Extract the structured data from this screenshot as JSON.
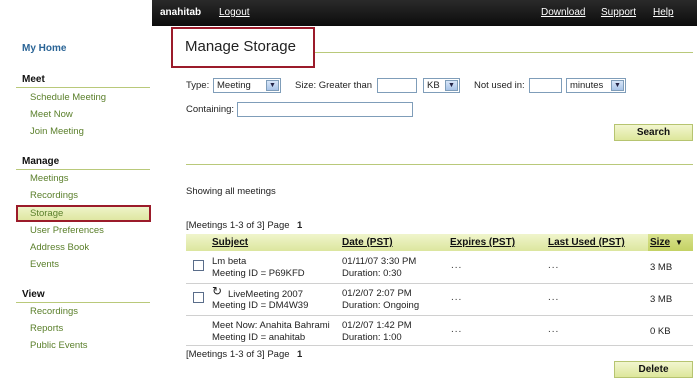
{
  "topbar": {
    "user": "anahitab",
    "logout": "Logout",
    "download": "Download",
    "support": "Support",
    "help": "Help"
  },
  "sidebar": {
    "home": "My Home",
    "meet": {
      "title": "Meet",
      "items": [
        "Schedule Meeting",
        "Meet Now",
        "Join Meeting"
      ]
    },
    "manage": {
      "title": "Manage",
      "items": [
        "Meetings",
        "Recordings",
        "Storage",
        "User Preferences",
        "Address Book",
        "Events"
      ]
    },
    "view": {
      "title": "View",
      "items": [
        "Recordings",
        "Reports",
        "Public Events"
      ]
    }
  },
  "page": {
    "title": "Manage Storage"
  },
  "filters": {
    "type_label": "Type:",
    "type_value": "Meeting",
    "size_label": "Size: Greater than",
    "size_value": "",
    "size_unit": "KB",
    "not_used_label": "Not used in:",
    "not_used_value": "",
    "not_used_unit": "minutes",
    "containing_label": "Containing:",
    "containing_value": "",
    "search_button": "Search"
  },
  "status": "Showing all meetings",
  "pager": {
    "text": "[Meetings 1-3 of 3] Page",
    "page": "1"
  },
  "table": {
    "columns": [
      "Subject",
      "Date (PST)",
      "Expires (PST)",
      "Last Used (PST)",
      "Size"
    ],
    "rows": [
      {
        "subject": "Lm beta",
        "meeting_id": "Meeting ID = P69KFD",
        "date": "01/11/07 3:30 PM",
        "duration": "Duration: 0:30",
        "expires": "...",
        "last_used": "...",
        "size": "3 MB",
        "checkbox": true,
        "recurring": false
      },
      {
        "subject": "LiveMeeting 2007",
        "meeting_id": "Meeting ID = DM4W39",
        "date": "01/2/07 2:07 PM",
        "duration": "Duration: Ongoing",
        "expires": "...",
        "last_used": "...",
        "size": "3 MB",
        "checkbox": true,
        "recurring": true
      },
      {
        "subject": "Meet Now: Anahita Bahrami",
        "meeting_id": "Meeting ID = anahitab",
        "date": "01/2/07 1:42 PM",
        "duration": "Duration: 1:00",
        "expires": "...",
        "last_used": "...",
        "size": "0 KB",
        "checkbox": false,
        "recurring": false
      }
    ]
  },
  "delete_button": "Delete",
  "icons": {
    "sort": "sort-descending-icon",
    "dropdown": "chevron-down-icon",
    "recurring": "refresh-icon"
  },
  "colors": {
    "accent_green": "#dce69e",
    "highlight_red": "#9b1b2a",
    "link_green": "#5a7f2a",
    "link_blue": "#2a6496"
  }
}
